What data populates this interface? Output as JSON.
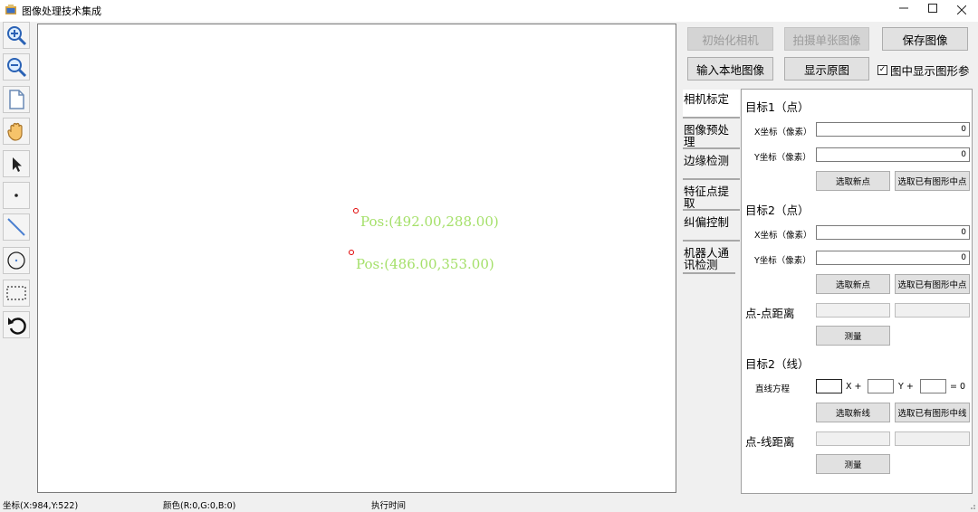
{
  "window": {
    "title": "图像处理技术集成",
    "app_icon": "app-icon",
    "minimize_icon": "minimize-icon",
    "maximize_icon": "maximize-icon",
    "close_icon": "close-icon"
  },
  "toolbar": {
    "tools": [
      "zoom-in-icon",
      "zoom-out-icon",
      "page-icon",
      "hand-icon",
      "pointer-icon",
      "point-icon",
      "line-icon",
      "circle-icon",
      "rectangle-select-icon",
      "undo-icon"
    ]
  },
  "canvas": {
    "marker_color": "#e00000",
    "label_color": "#a5e06a",
    "labels": [
      "Pos:(492.00,288.00)",
      "Pos:(486.00,353.00)"
    ]
  },
  "top_buttons": {
    "init_camera": "初始化相机",
    "capture_single": "拍摄单张图像",
    "save_image": "保存图像",
    "load_local": "输入本地图像",
    "show_original": "显示原图",
    "show_shape_params": "图中显示图形参"
  },
  "tabs": [
    "相机标定",
    "图像预处理",
    "边缘检测",
    "特征点提取",
    "纠偏控制",
    "机器人通讯检测"
  ],
  "panel": {
    "target1": {
      "title": "目标1（点）",
      "x_label": "X坐标（像素）",
      "x_value": "0",
      "y_label": "Y坐标（像素）",
      "y_value": "0",
      "select_new": "选取新点",
      "select_existing": "选取已有图形中点"
    },
    "target2": {
      "title": "目标2（点）",
      "x_label": "X坐标（像素）",
      "x_value": "0",
      "y_label": "Y坐标（像素）",
      "y_value": "0",
      "select_new": "选取新点",
      "select_existing": "选取已有图形中点"
    },
    "point_distance": {
      "label": "点-点距离",
      "measure": "测量"
    },
    "target2_line": {
      "title": "目标2（线）",
      "equation_label": "直线方程",
      "x_sym": "X  +",
      "y_sym": "Y  +",
      "eq_sym": "=  0",
      "select_new": "选取新线",
      "select_existing": "选取已有图形中线"
    },
    "line_distance": {
      "label": "点-线距离",
      "measure": "测量"
    }
  },
  "status": {
    "coords": "坐标(X:984,Y:522)",
    "color": "颜色(R:0,G:0,B:0)",
    "exec_time": "执行时间"
  }
}
